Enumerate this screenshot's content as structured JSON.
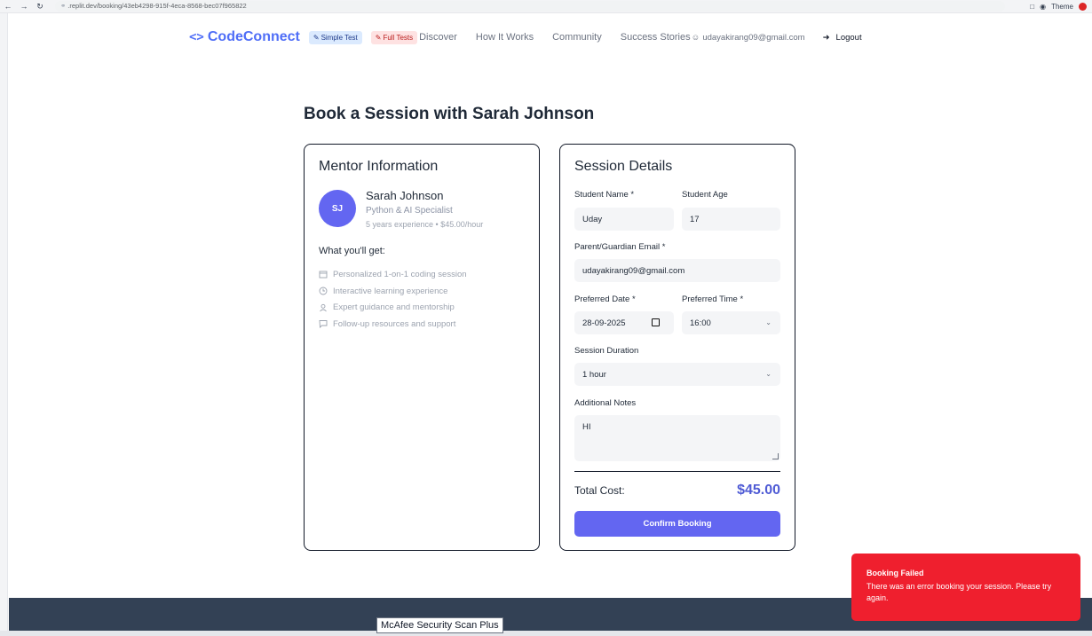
{
  "browser": {
    "url": ".replit.dev/booking/43eb4298-915f-4eca-8568-bec07f965822",
    "theme_label": "Theme"
  },
  "nav": {
    "brand": "CodeConnect",
    "brand_icon": "<>",
    "pill_simple": "Simple Test",
    "pill_full": "Full Tests",
    "links": [
      "Discover",
      "How It Works",
      "Community",
      "Success Stories"
    ],
    "user_email": "udayakirang09@gmail.com",
    "logout": "Logout"
  },
  "page": {
    "title": "Book a Session with Sarah Johnson"
  },
  "mentor": {
    "card_title": "Mentor Information",
    "initials": "SJ",
    "name": "Sarah Johnson",
    "specialty": "Python & AI Specialist",
    "experience": "5 years experience • $45.00/hour",
    "benefits_heading": "What you'll get:",
    "benefits": [
      {
        "icon": "calendar-icon",
        "text": "Personalized 1-on-1 coding session"
      },
      {
        "icon": "clock-icon",
        "text": "Interactive learning experience"
      },
      {
        "icon": "user-icon",
        "text": "Expert guidance and mentorship"
      },
      {
        "icon": "message-icon",
        "text": "Follow-up resources and support"
      }
    ]
  },
  "session": {
    "card_title": "Session Details",
    "student_name_label": "Student Name *",
    "student_name_value": "Uday",
    "student_age_label": "Student Age",
    "student_age_value": "17",
    "email_label": "Parent/Guardian Email *",
    "email_value": "udayakirang09@gmail.com",
    "date_label": "Preferred Date *",
    "date_value": "28-09-2025",
    "time_label": "Preferred Time *",
    "time_value": "16:00",
    "duration_label": "Session Duration",
    "duration_value": "1 hour",
    "notes_label": "Additional Notes",
    "notes_value": "HI",
    "cost_label": "Total Cost:",
    "cost_value": "$45.00",
    "confirm_label": "Confirm Booking"
  },
  "tooltip": {
    "text": "McAfee Security Scan Plus"
  },
  "toast": {
    "title": "Booking Failed",
    "message": "There was an error booking your session. Please try again."
  },
  "colors": {
    "accent": "#6366f1",
    "brand": "#4f6ef7",
    "error": "#ef1f2e",
    "footer": "#334155"
  }
}
